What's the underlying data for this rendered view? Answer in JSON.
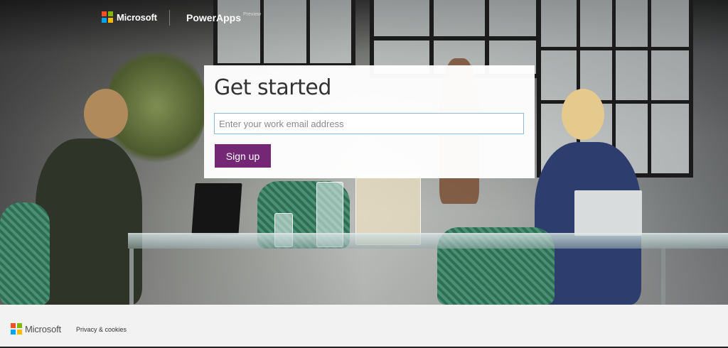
{
  "header": {
    "brand": "Microsoft",
    "product": "PowerApps",
    "product_tag": "Preview"
  },
  "card": {
    "title": "Get started",
    "email_placeholder": "Enter your work email address",
    "email_value": "",
    "signup_label": "Sign up"
  },
  "footer": {
    "brand": "Microsoft",
    "privacy_link": "Privacy & cookies"
  },
  "colors": {
    "brand_purple": "#742774",
    "logo_red": "#f25022",
    "logo_green": "#7fba00",
    "logo_blue": "#00a4ef",
    "logo_yellow": "#ffb900"
  }
}
